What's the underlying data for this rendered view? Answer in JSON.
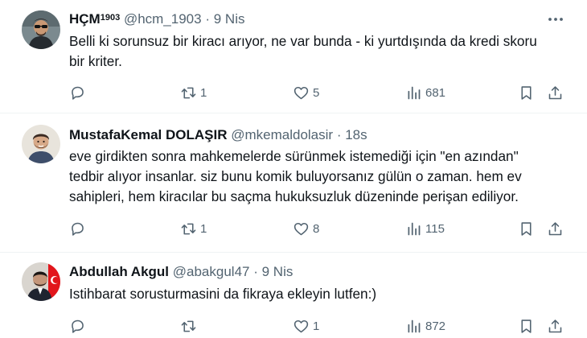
{
  "tweets": [
    {
      "name": "HÇM",
      "name_sup": "1903",
      "handle": "@hcm_1903",
      "dot": "·",
      "time": "9 Nis",
      "avatar_icon": "avatar-man-sunglasses",
      "lines": [
        "Belli ki sorunsuz bir kiracı arıyor, ne var bunda - ki yurtdışında da kredi skoru",
        "bir kriter."
      ],
      "replies": "",
      "retweets": "1",
      "likes": "5",
      "views": "681"
    },
    {
      "name": "MustafaKemal DOLAŞIR",
      "name_sup": "",
      "handle": "@mkemaldolasir",
      "dot": "·",
      "time": "18s",
      "avatar_icon": "avatar-man-beard",
      "lines": [
        "eve girdikten sonra mahkemelerde sürünmek istemediği için \"en azından\"",
        "tedbir alıyor insanlar. siz bunu komik buluyorsanız gülün o zaman. hem ev",
        "sahipleri, hem kiracılar bu saçma hukuksuzluk düzeninde perişan ediliyor."
      ],
      "replies": "",
      "retweets": "1",
      "likes": "8",
      "views": "115"
    },
    {
      "name": "Abdullah Akgul",
      "name_sup": "",
      "handle": "@abakgul47",
      "dot": "·",
      "time": "9 Nis",
      "avatar_icon": "avatar-man-suit-flag",
      "lines": [
        "Istihbarat sorusturmasini da fikraya ekleyin lutfen:)"
      ],
      "replies": "",
      "retweets": "",
      "likes": "1",
      "views": "872"
    }
  ]
}
